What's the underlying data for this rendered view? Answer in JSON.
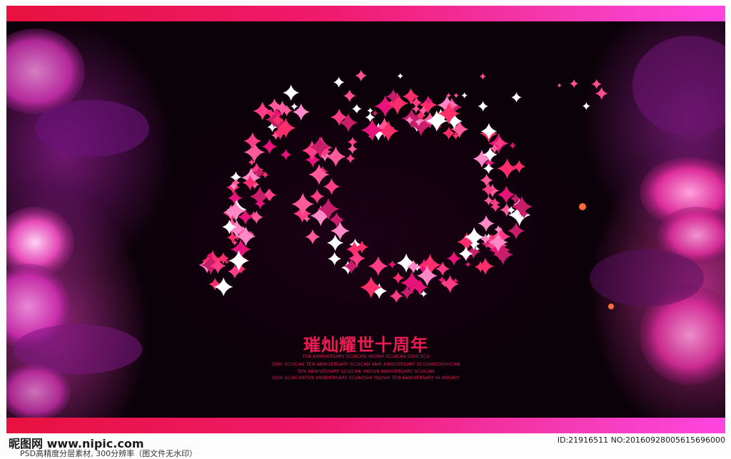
{
  "poster": {
    "headline": "璀灿耀世十周年",
    "sublines": [
      "TEN ANNIVERSARY SCUICAN YAOSHI SCUICAN OSHI SCU",
      "OSHI SCUICAN TEN ANNIVERSARY SCUICAN YAHI ANNIVERSARY SCUSHISCUSHICAN",
      "TEN ANNIVERSARY SCUICAN YAOSHI ANNIVERSARY SCUICAN",
      "OSHI SCUICANTEN ANNIVERSARY SCUAOSHI YAOSHI TEN ANNIVERSARY HI ARSARY"
    ],
    "colors": {
      "band_start": "#e8113f",
      "band_end": "#ff45e2",
      "headline": "#ee1c55",
      "background": "#0b0108"
    }
  },
  "watermark": {
    "site": "昵图网 www.nipic.com",
    "id_text": "ID:21916511 NO:20160928005615696000",
    "bottom_text": "PSD高精度分层素材, 300分辨率（图文件无水印）"
  }
}
